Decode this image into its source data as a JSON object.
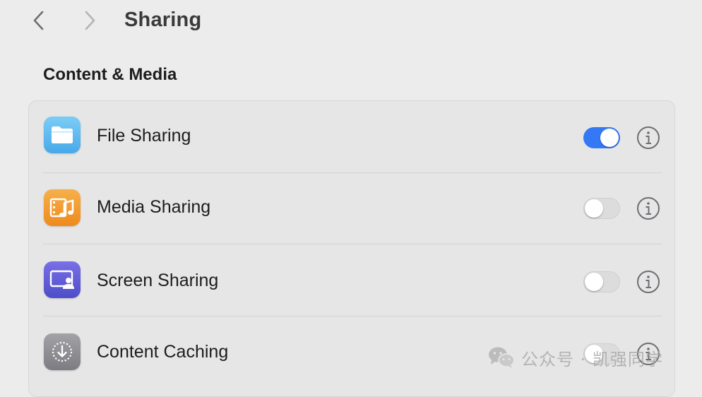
{
  "header": {
    "back_icon": "chevron-left-icon",
    "forward_icon": "chevron-right-icon",
    "title": "Sharing"
  },
  "section": {
    "title": "Content & Media"
  },
  "rows": [
    {
      "label": "File Sharing",
      "icon": "folder-icon",
      "icon_color": "#5ab8ef",
      "enabled": true
    },
    {
      "label": "Media Sharing",
      "icon": "media-film-music-icon",
      "icon_color": "#f39a2d",
      "enabled": false
    },
    {
      "label": "Screen Sharing",
      "icon": "screen-sharing-icon",
      "icon_color": "#5b5bd6",
      "enabled": false
    },
    {
      "label": "Content Caching",
      "icon": "download-circle-icon",
      "icon_color": "#8e8e93",
      "enabled": false
    }
  ],
  "toggle_on_color": "#3478f6",
  "info_icon": "info-circle-icon",
  "watermark": {
    "icon": "wechat-icon",
    "text": "公众号 · 凯强同学"
  }
}
